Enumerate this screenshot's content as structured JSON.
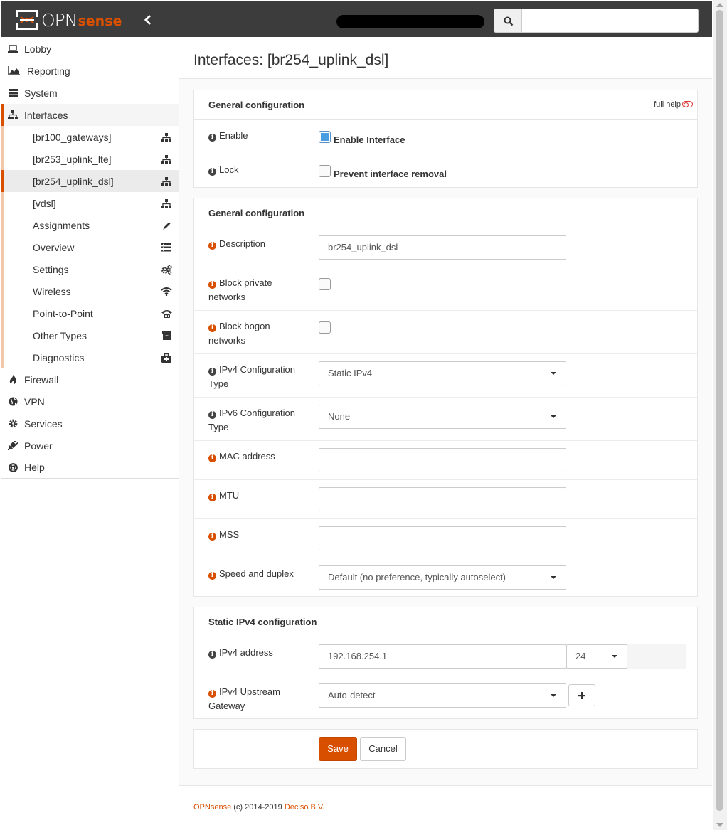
{
  "brand": {
    "name_main": "OPN",
    "name_sense": "sense"
  },
  "search": {
    "placeholder": ""
  },
  "sidebar": {
    "items": [
      {
        "label": "Lobby",
        "icon": "laptop-icon"
      },
      {
        "label": "Reporting",
        "icon": "area-chart-icon"
      },
      {
        "label": "System",
        "icon": "server-icon"
      },
      {
        "label": "Interfaces",
        "icon": "sitemap-icon"
      }
    ],
    "interfaces_sub": [
      {
        "label": "[br100_gateways]",
        "icon": "sitemap-icon"
      },
      {
        "label": "[br253_uplink_lte]",
        "icon": "sitemap-icon"
      },
      {
        "label": "[br254_uplink_dsl]",
        "icon": "sitemap-icon"
      },
      {
        "label": "[vdsl]",
        "icon": "sitemap-icon"
      },
      {
        "label": "Assignments",
        "icon": "pencil-icon"
      },
      {
        "label": "Overview",
        "icon": "list-icon"
      },
      {
        "label": "Settings",
        "icon": "cogs-icon"
      },
      {
        "label": "Wireless",
        "icon": "wifi-icon"
      },
      {
        "label": "Point-to-Point",
        "icon": "phone-icon"
      },
      {
        "label": "Other Types",
        "icon": "archive-icon"
      },
      {
        "label": "Diagnostics",
        "icon": "medkit-icon"
      }
    ],
    "bottom_items": [
      {
        "label": "Firewall",
        "icon": "fire-icon"
      },
      {
        "label": "VPN",
        "icon": "globe-icon"
      },
      {
        "label": "Services",
        "icon": "gear-icon"
      },
      {
        "label": "Power",
        "icon": "plug-icon"
      },
      {
        "label": "Help",
        "icon": "life-ring-icon"
      }
    ]
  },
  "page": {
    "title": "Interfaces: [br254_uplink_dsl]"
  },
  "panel1": {
    "heading": "General configuration",
    "full_help": "full help",
    "enable_label": "Enable",
    "enable_checkbox_label": "Enable Interface",
    "enable_checked": true,
    "lock_label": "Lock",
    "lock_checkbox_label": "Prevent interface removal",
    "lock_checked": false
  },
  "panel2": {
    "heading": "General configuration",
    "description_label": "Description",
    "description_value": "br254_uplink_dsl",
    "block_private_label": "Block private networks",
    "block_bogon_label": "Block bogon networks",
    "ipv4_type_label": "IPv4 Configuration Type",
    "ipv4_type_value": "Static IPv4",
    "ipv6_type_label": "IPv6 Configuration Type",
    "ipv6_type_value": "None",
    "mac_label": "MAC address",
    "mac_value": "",
    "mtu_label": "MTU",
    "mtu_value": "",
    "mss_label": "MSS",
    "mss_value": "",
    "speed_label": "Speed and duplex",
    "speed_value": "Default (no preference, typically autoselect)"
  },
  "panel3": {
    "heading": "Static IPv4 configuration",
    "ipv4_address_label": "IPv4 address",
    "ipv4_address_value": "192.168.254.1",
    "subnet_value": "24",
    "gateway_label": "IPv4 Upstream Gateway",
    "gateway_value": "Auto-detect"
  },
  "actions": {
    "save": "Save",
    "cancel": "Cancel"
  },
  "footer": {
    "brand": "OPNsense",
    "copyright": "(c) 2014-2019",
    "company": "Deciso B.V."
  },
  "colors": {
    "accent": "#d94f00",
    "topbar": "#3c3c3c"
  }
}
